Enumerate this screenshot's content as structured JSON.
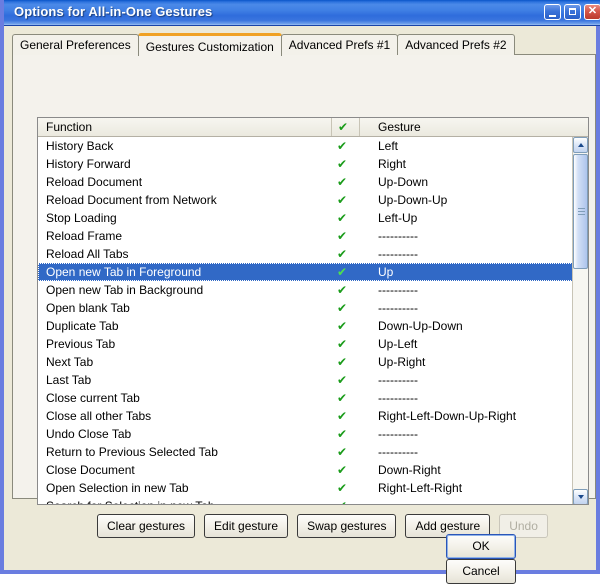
{
  "window": {
    "title": "Options for All-in-One Gestures",
    "controls": {
      "minimize": "minimize-button",
      "maximize": "maximize-button",
      "close": "✕"
    }
  },
  "tabs": [
    {
      "label": "General Preferences",
      "active": false
    },
    {
      "label": "Gestures Customization",
      "active": true
    },
    {
      "label": "Advanced Prefs #1",
      "active": false
    },
    {
      "label": "Advanced Prefs #2",
      "active": false
    }
  ],
  "list": {
    "columns": {
      "function": "Function",
      "check": "✔",
      "gesture": "Gesture"
    },
    "selected_index": 7,
    "rows": [
      {
        "function": "History Back",
        "check": "✔",
        "gesture": "Left"
      },
      {
        "function": "History Forward",
        "check": "✔",
        "gesture": "Right"
      },
      {
        "function": "Reload Document",
        "check": "✔",
        "gesture": "Up-Down"
      },
      {
        "function": "Reload Document from Network",
        "check": "✔",
        "gesture": "Up-Down-Up"
      },
      {
        "function": "Stop Loading",
        "check": "✔",
        "gesture": "Left-Up"
      },
      {
        "function": "Reload Frame",
        "check": "✔",
        "gesture": "----------"
      },
      {
        "function": "Reload All Tabs",
        "check": "✔",
        "gesture": "----------"
      },
      {
        "function": "Open new Tab in Foreground",
        "check": "✔",
        "gesture": "Up"
      },
      {
        "function": "Open new Tab in Background",
        "check": "✔",
        "gesture": "----------"
      },
      {
        "function": "Open blank Tab",
        "check": "✔",
        "gesture": "----------"
      },
      {
        "function": "Duplicate Tab",
        "check": "✔",
        "gesture": "Down-Up-Down"
      },
      {
        "function": "Previous Tab",
        "check": "✔",
        "gesture": "Up-Left"
      },
      {
        "function": "Next Tab",
        "check": "✔",
        "gesture": "Up-Right"
      },
      {
        "function": "Last Tab",
        "check": "✔",
        "gesture": "----------"
      },
      {
        "function": "Close current Tab",
        "check": "✔",
        "gesture": "----------"
      },
      {
        "function": "Close all other Tabs",
        "check": "✔",
        "gesture": "Right-Left-Down-Up-Right"
      },
      {
        "function": "Undo Close Tab",
        "check": "✔",
        "gesture": "----------"
      },
      {
        "function": "Return to Previous Selected Tab",
        "check": "✔",
        "gesture": "----------"
      },
      {
        "function": "Close Document",
        "check": "✔",
        "gesture": "Down-Right"
      },
      {
        "function": "Open Selection in new Tab",
        "check": "✔",
        "gesture": "Right-Left-Right"
      },
      {
        "function": "Search for Selection in new Tab",
        "check": "✔",
        "gesture": ""
      }
    ]
  },
  "actions": [
    {
      "label": "Clear gestures",
      "disabled": false
    },
    {
      "label": "Edit gesture",
      "disabled": false
    },
    {
      "label": "Swap gestures",
      "disabled": false
    },
    {
      "label": "Add gesture",
      "disabled": false
    },
    {
      "label": "Undo",
      "disabled": true
    }
  ],
  "footer": {
    "ok": "OK",
    "cancel": "Cancel"
  },
  "colors": {
    "title_bar": "#2f6cdc",
    "active_tab_accent": "#f0a124",
    "selection": "#3169c6",
    "check_green": "#1a9c1a",
    "dialog_bg": "#ece9d8",
    "panel_bg": "#f4f2ec"
  }
}
